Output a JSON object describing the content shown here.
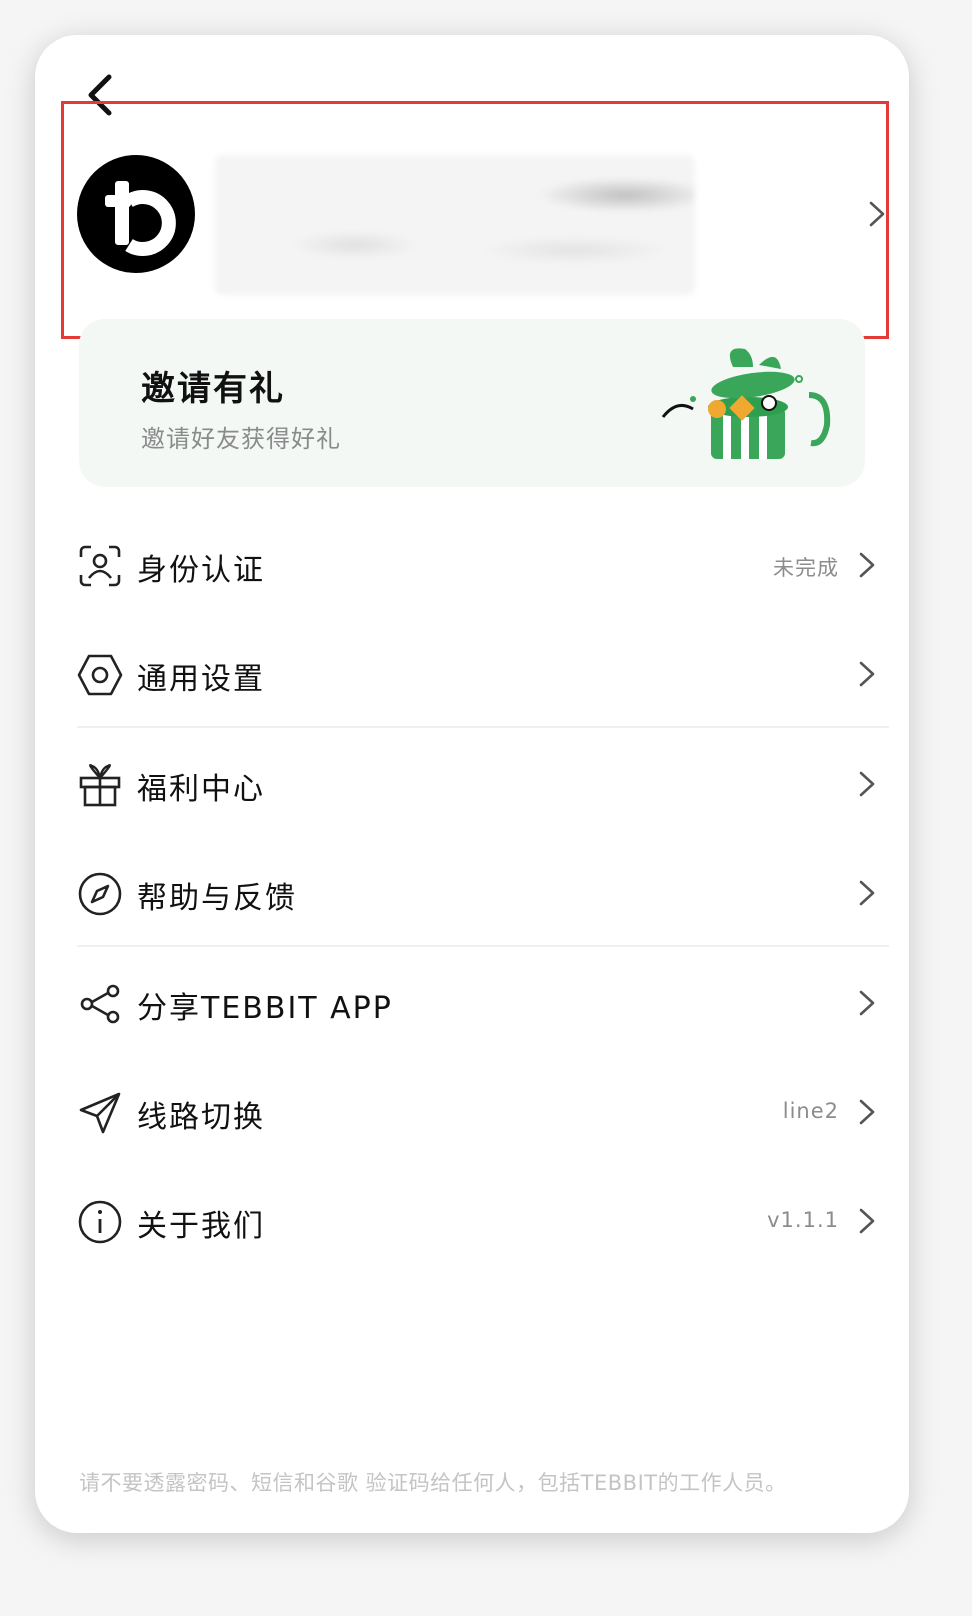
{
  "invite": {
    "title": "邀请有礼",
    "subtitle": "邀请好友获得好礼"
  },
  "menu": {
    "items": [
      {
        "label": "身份认证",
        "value": "未完成",
        "icon": "person-scan-icon"
      },
      {
        "label": "通用设置",
        "value": "",
        "icon": "hexagon-settings-icon"
      },
      {
        "label": "福利中心",
        "value": "",
        "icon": "gift-icon"
      },
      {
        "label": "帮助与反馈",
        "value": "",
        "icon": "compass-icon"
      },
      {
        "label": "分享TEBBIT APP",
        "value": "",
        "icon": "share-icon"
      },
      {
        "label": "线路切换",
        "value": "line2",
        "icon": "send-icon"
      },
      {
        "label": "关于我们",
        "value": "v1.1.1",
        "icon": "info-icon"
      }
    ]
  },
  "footer": {
    "notice": "请不要透露密码、短信和谷歌 验证码给任何人，包括TEBBIT的工作人员。"
  },
  "colors": {
    "highlight": "#e53935",
    "accent_green": "#2e9e4f",
    "card_bg": "#f3f8f5"
  }
}
